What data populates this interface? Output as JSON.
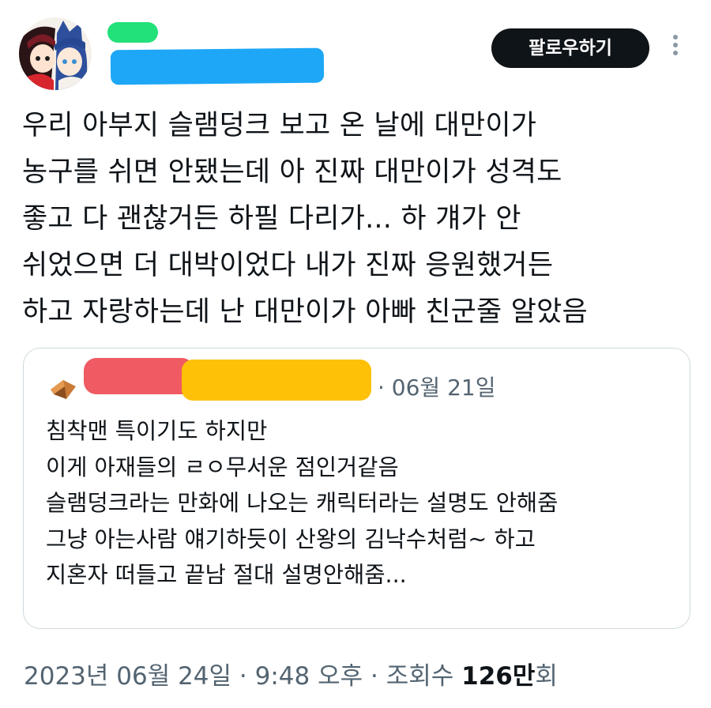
{
  "header": {
    "follow_label": "팔로우하기",
    "name_redaction_color": "#22e07a",
    "handle_redaction_color": "#1ea7f6"
  },
  "tweet": {
    "lines": [
      "우리 아부지 슬램덩크 보고 온 날에 대만이가",
      "농구를 쉬면 안됐는데 아 진짜 대만이가 성격도",
      "좋고 다 괜찮거든 하필 다리가... 하 걔가 안",
      "쉬었으면 더 대박이었다 내가 진짜 응원했거든",
      "하고 자랑하는데 난 대만이가 아빠 친군줄 알았음"
    ]
  },
  "quote": {
    "date": "· 06월 21일",
    "name_redaction_color": "#f05a63",
    "handle_redaction_color": "#ffc107",
    "lines": [
      "침착맨 특이기도 하지만",
      "이게 아재들의 ㄹㅇ무서운 점인거같음",
      "슬램덩크라는 만화에 나오는 캐릭터라는 설명도 안해줌",
      "그냥 아는사람 얘기하듯이 산왕의 김낙수처럼~ 하고",
      "지혼자 떠들고 끝남 절대 설명안해줌..."
    ]
  },
  "meta": {
    "date": "2023년 06월 24일",
    "sep1": " · ",
    "time": "9:48 오후",
    "sep2": " · ",
    "views_label": "조회수 ",
    "views_number": "126",
    "views_unit_bold": "만",
    "views_suffix": "회"
  }
}
